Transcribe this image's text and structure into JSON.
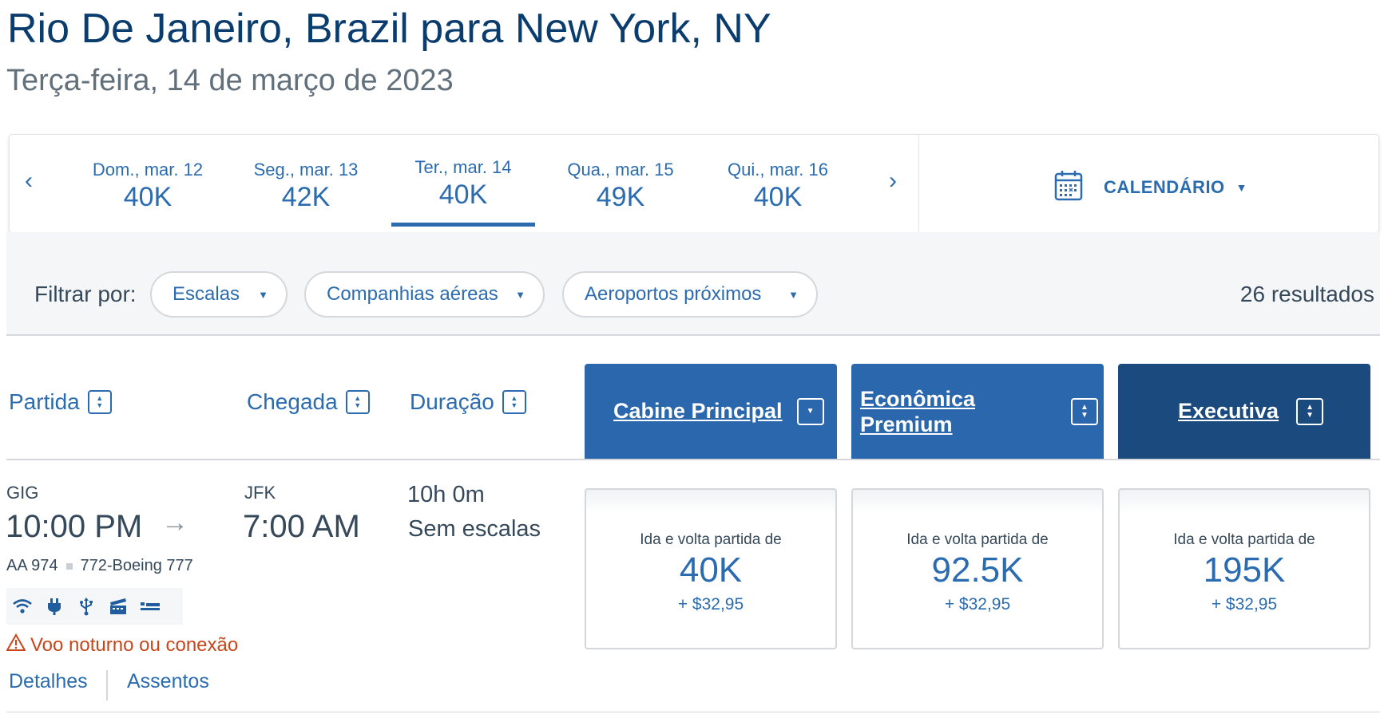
{
  "header": {
    "title": "Rio De Janeiro, Brazil para New York, NY",
    "subtitle": "Terça-feira, 14 de março de 2023"
  },
  "date_strip": {
    "prev": "‹",
    "next": "›",
    "days": [
      {
        "label": "Dom., mar. 12",
        "points": "40K"
      },
      {
        "label": "Seg., mar. 13",
        "points": "42K"
      },
      {
        "label": "Ter., mar. 14",
        "points": "40K",
        "selected": true
      },
      {
        "label": "Qua., mar. 15",
        "points": "49K"
      },
      {
        "label": "Qui., mar. 16",
        "points": "40K"
      }
    ],
    "calendar_label": "CALENDÁRIO",
    "calendar_icon": "calendar-icon"
  },
  "filters": {
    "label": "Filtrar por:",
    "options": [
      "Escalas",
      "Companhias aéreas",
      "Aeroportos próximos"
    ],
    "results": "26 resultados"
  },
  "columns": {
    "departure": "Partida",
    "arrival": "Chegada",
    "duration": "Duração"
  },
  "cabins": [
    {
      "name": "Cabine Principal",
      "color": "#2a67ad",
      "control": "dropdown"
    },
    {
      "name": "Econômica Premium",
      "color": "#2a67ad",
      "control": "sort"
    },
    {
      "name": "Executiva",
      "color": "#1b4a7e",
      "control": "sort"
    }
  ],
  "flight": {
    "origin": "GIG",
    "depart_time": "10:00 PM",
    "destination": "JFK",
    "arrive_time": "7:00 AM",
    "duration": "10h 0m",
    "stops": "Sem escalas",
    "flight_number": "AA 974",
    "aircraft": "772-Boeing 777",
    "amenities": [
      "wifi-icon",
      "power-outlet-icon",
      "usb-icon",
      "entertainment-icon",
      "lie-flat-seat-icon"
    ],
    "warning": "Voo noturno ou conexão",
    "details_link": "Detalhes",
    "seats_link": "Assentos",
    "fares": [
      {
        "label": "Ida e volta partida de",
        "points": "40K",
        "tax": "+ $32,95"
      },
      {
        "label": "Ida e volta partida de",
        "points": "92.5K",
        "tax": "+ $32,95"
      },
      {
        "label": "Ida e volta partida de",
        "points": "195K",
        "tax": "+ $32,95"
      }
    ]
  },
  "colors": {
    "brand_blue": "#2b6cb0",
    "title_navy": "#0b3c6e",
    "warning_orange": "#c7461a"
  }
}
